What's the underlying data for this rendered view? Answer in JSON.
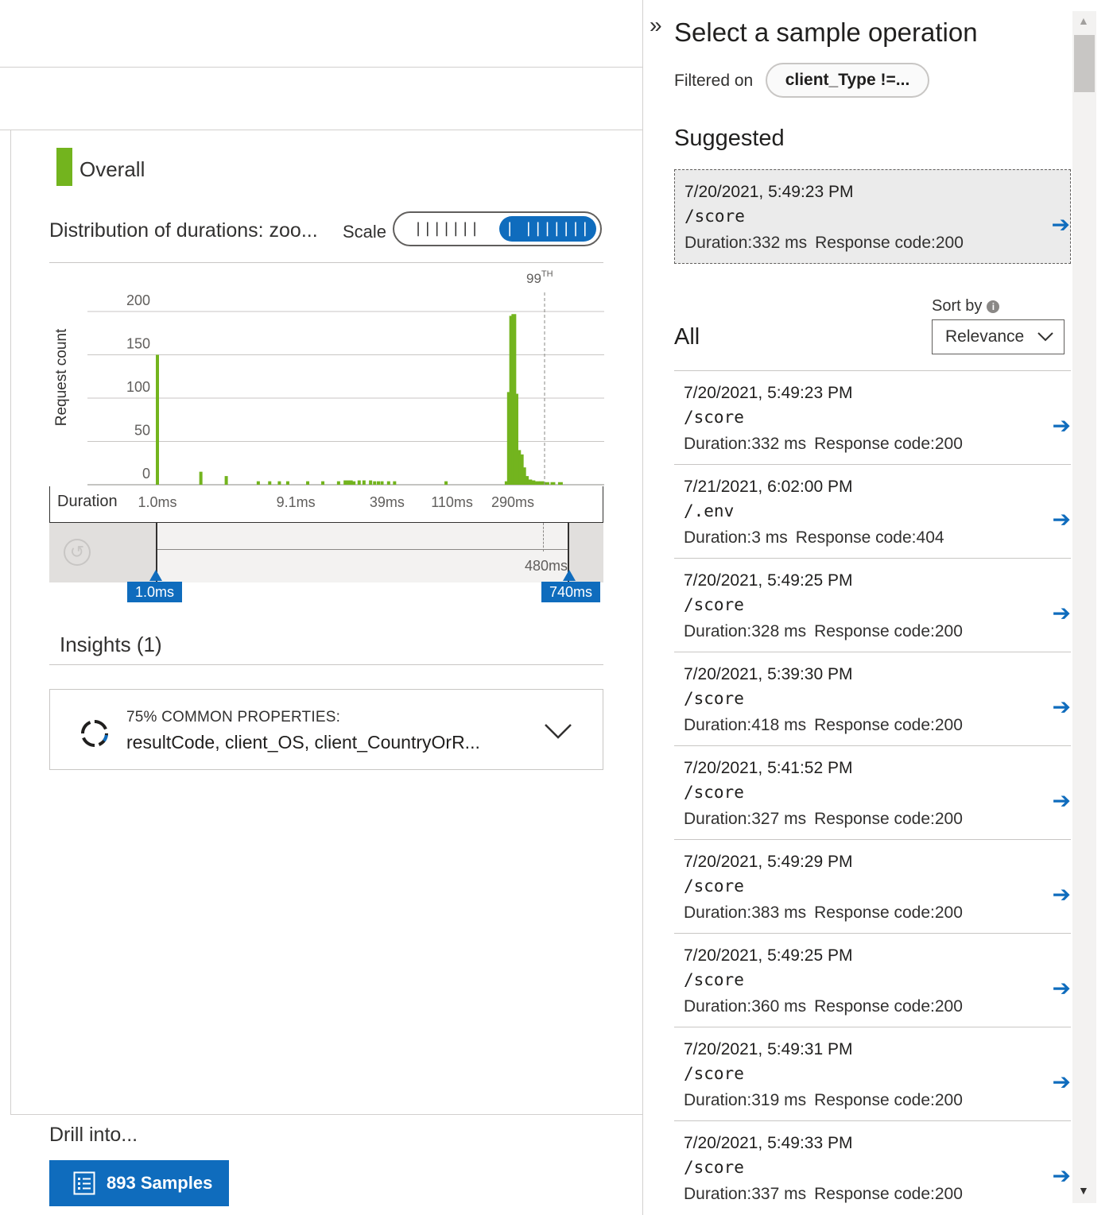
{
  "legend": {
    "label": "Overall",
    "color": "#73b41e"
  },
  "distribution": {
    "title": "Distribution of durations: zoo...",
    "scale_label": "Scale",
    "scale_options": [
      "|||||||",
      "| |||||||"
    ],
    "scale_selected": "log",
    "duration_label": "Duration"
  },
  "chart_data": {
    "type": "bar",
    "ylabel": "Request count",
    "ylim": [
      0,
      200
    ],
    "y_ticks": [
      "200",
      "150",
      "100",
      "50",
      "0"
    ],
    "x_scale": "log",
    "x_ticks": [
      "1.0ms",
      "9.1ms",
      "39ms",
      "110ms",
      "290ms"
    ],
    "percentile_marker": "99TH",
    "color": "#73b41e",
    "bins_ms": [
      1.0,
      2.0,
      3.0,
      5.0,
      6.0,
      7.0,
      8.0,
      11.0,
      14.0,
      18.0,
      20.0,
      21.0,
      22.0,
      23.0,
      25.0,
      27.0,
      30.0,
      32.0,
      34.0,
      36.0,
      40.0,
      44.0,
      100.0,
      265.0,
      275.0,
      285.0,
      295.0,
      305.0,
      318.0,
      332.0,
      345.0,
      360.0,
      380.0,
      400.0,
      430.0,
      460.0,
      500.0,
      550.0,
      620.0
    ],
    "values": [
      150,
      15,
      10,
      4,
      4,
      4,
      4,
      4,
      4,
      4,
      5,
      5,
      5,
      4,
      5,
      5,
      5,
      4,
      4,
      4,
      4,
      4,
      4,
      4,
      107,
      195,
      197,
      105,
      40,
      35,
      20,
      10,
      6,
      5,
      4,
      4,
      3,
      3,
      3
    ]
  },
  "brush": {
    "range_label": "480ms",
    "left_handle": "1.0ms",
    "right_handle": "740ms"
  },
  "insights": {
    "title": "Insights (1)",
    "card_heading": "75% COMMON PROPERTIES:",
    "card_body": "resultCode, client_OS, client_CountryOrR..."
  },
  "drill": {
    "label": "Drill into...",
    "button_label": "893 Samples"
  },
  "panel": {
    "title": "Select a sample operation",
    "filter_label": "Filtered on",
    "filter_value": "client_Type !=...",
    "suggested_title": "Suggested",
    "all_title": "All",
    "sort_label": "Sort by",
    "sort_value": "Relevance",
    "duration_prefix": "Duration:",
    "response_prefix": "Response code:"
  },
  "suggested": {
    "date": "7/20/2021, 5:49:23 PM",
    "name": "/score",
    "duration": "332 ms",
    "code": "200"
  },
  "operations": [
    {
      "date": "7/20/2021, 5:49:23 PM",
      "name": "/score",
      "duration": "332 ms",
      "code": "200"
    },
    {
      "date": "7/21/2021, 6:02:00 PM",
      "name": "/.env",
      "duration": "3 ms",
      "code": "404"
    },
    {
      "date": "7/20/2021, 5:49:25 PM",
      "name": "/score",
      "duration": "328 ms",
      "code": "200"
    },
    {
      "date": "7/20/2021, 5:39:30 PM",
      "name": "/score",
      "duration": "418 ms",
      "code": "200"
    },
    {
      "date": "7/20/2021, 5:41:52 PM",
      "name": "/score",
      "duration": "327 ms",
      "code": "200"
    },
    {
      "date": "7/20/2021, 5:49:29 PM",
      "name": "/score",
      "duration": "383 ms",
      "code": "200"
    },
    {
      "date": "7/20/2021, 5:49:25 PM",
      "name": "/score",
      "duration": "360 ms",
      "code": "200"
    },
    {
      "date": "7/20/2021, 5:49:31 PM",
      "name": "/score",
      "duration": "319 ms",
      "code": "200"
    },
    {
      "date": "7/20/2021, 5:49:33 PM",
      "name": "/score",
      "duration": "337 ms",
      "code": "200"
    }
  ]
}
